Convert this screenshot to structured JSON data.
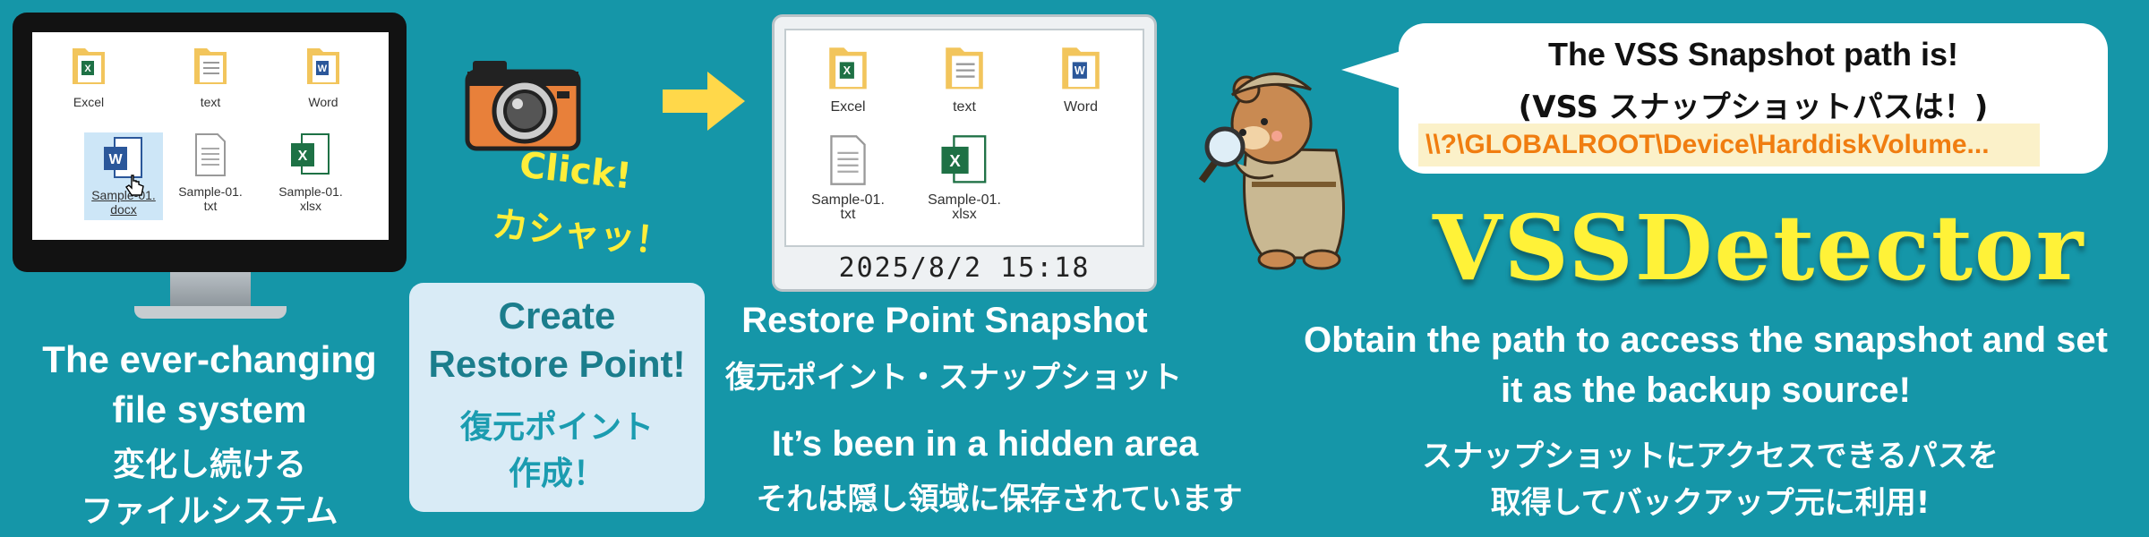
{
  "left_panel": {
    "files": [
      {
        "label": "Excel",
        "icon": "excel-folder-icon"
      },
      {
        "label": "text",
        "icon": "text-folder-icon"
      },
      {
        "label": "Word",
        "icon": "word-folder-icon"
      },
      {
        "label": "Sample-01.\ndocx",
        "icon": "word-file-icon"
      },
      {
        "label": "Sample-01.\ntxt",
        "icon": "text-file-icon"
      },
      {
        "label": "Sample-01.\nxlsx",
        "icon": "excel-file-icon"
      }
    ],
    "caption_en_1": "The ever-changing",
    "caption_en_2": "file system",
    "caption_jp_1": "変化し続ける",
    "caption_jp_2": "ファイルシステム"
  },
  "camera": {
    "icon": "camera-icon",
    "click": "Click!",
    "kasha": "カシャッ！"
  },
  "create_box": {
    "title_1": "Create",
    "title_2": "Restore Point!",
    "jp_1": "復元ポイント",
    "jp_2": "作成！"
  },
  "snapshot": {
    "files": [
      {
        "label": "Excel"
      },
      {
        "label": "text"
      },
      {
        "label": "Word"
      },
      {
        "label": "Sample-01.\ntxt"
      },
      {
        "label": "Sample-01.\nxlsx"
      }
    ],
    "timestamp": "2025/8/2 15:18",
    "title": "Restore Point Snapshot",
    "title_jp": "復元ポイント・スナップショット",
    "hidden_en": "It’s been in a hidden area",
    "hidden_jp": "それは隠し領域に保存されています"
  },
  "bubble": {
    "line1": "The VSS Snapshot path is!",
    "line2": "(VSS スナップショットパスは！)",
    "path": "\\\\?\\GLOBALROOT\\Device\\HarddiskVolume..."
  },
  "brand": {
    "name": "VSSDetector",
    "desc_en_1": "Obtain the path to access the snapshot and set",
    "desc_en_2": "it as the backup source!",
    "desc_jp_1": "スナップショットにアクセスできるパスを",
    "desc_jp_2": "取得してバックアップ元に利用!"
  },
  "colors": {
    "background": "#1596a8",
    "accent_yellow": "#fff238",
    "create_text": "#1b7d8c",
    "path_text": "#f07d10"
  }
}
